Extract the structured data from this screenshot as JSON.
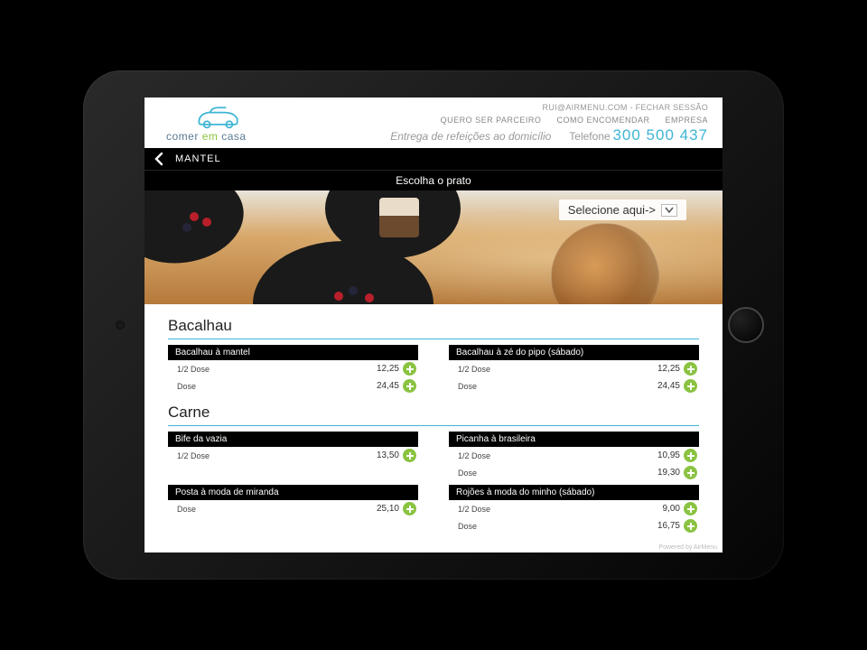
{
  "brand": {
    "name_prefix": "comer ",
    "name_em": "em",
    "name_suffix": " casa",
    "sub": "Entrega de refeições ao domicílio"
  },
  "session": {
    "email": "RUI@AIRMENU.COM",
    "sep": " - ",
    "logout": "FECHAR SESSÃO"
  },
  "nav": {
    "partner": "QUERO SER PARCEIRO",
    "how": "COMO ENCOMENDAR",
    "company": "EMPRESA"
  },
  "tagline": "Entrega de refeições ao domicílio",
  "phone": {
    "label": "Telefone",
    "number": "300 500 437"
  },
  "bar": {
    "title": "MANTEL"
  },
  "choose": "Escolha o prato",
  "selector": {
    "label": "Selecione aqui->"
  },
  "categories": [
    {
      "title": "Bacalhau",
      "dishes": [
        {
          "name": "Bacalhau à mantel",
          "rows": [
            {
              "label": "1/2 Dose",
              "price": "12,25"
            },
            {
              "label": "Dose",
              "price": "24,45"
            }
          ]
        },
        {
          "name": "Bacalhau à zé do pipo (sábado)",
          "rows": [
            {
              "label": "1/2 Dose",
              "price": "12,25"
            },
            {
              "label": "Dose",
              "price": "24,45"
            }
          ]
        }
      ]
    },
    {
      "title": "Carne",
      "dishes": [
        {
          "name": "Bife da vazia",
          "rows": [
            {
              "label": "1/2 Dose",
              "price": "13,50"
            }
          ]
        },
        {
          "name": "Picanha à brasileira",
          "rows": [
            {
              "label": "1/2 Dose",
              "price": "10,95"
            },
            {
              "label": "Dose",
              "price": "19,30"
            }
          ]
        },
        {
          "name": "Posta à moda de miranda",
          "rows": [
            {
              "label": "Dose",
              "price": "25,10"
            }
          ]
        },
        {
          "name": "Rojões à moda do minho (sábado)",
          "rows": [
            {
              "label": "1/2 Dose",
              "price": "9,00"
            },
            {
              "label": "Dose",
              "price": "16,75"
            }
          ]
        }
      ]
    }
  ],
  "powered": "Powered by AirMenu"
}
